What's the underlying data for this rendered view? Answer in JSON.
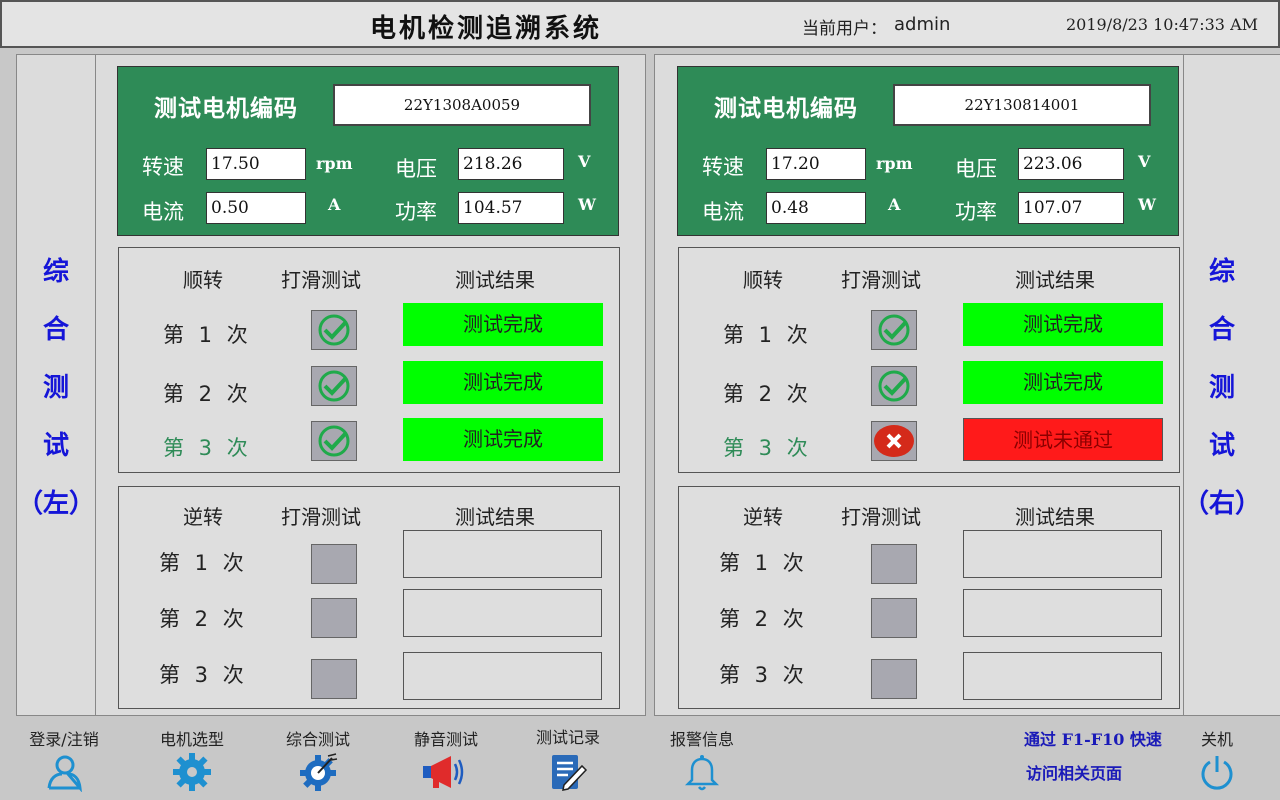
{
  "header": {
    "title": "电机检测追溯系统",
    "user_label": "当前用户：",
    "user_name": "admin",
    "datetime": "2019/8/23 10:47:33 AM"
  },
  "left": {
    "side_label": [
      "综",
      "合",
      "测",
      "试",
      "（左）"
    ],
    "motor_code_label": "测试电机编码",
    "motor_code": "22Y1308A0059",
    "speed_label": "转速",
    "speed": "17.50",
    "speed_unit": "rpm",
    "voltage_label": "电压",
    "voltage": "218.26",
    "voltage_unit": "V",
    "current_label": "电流",
    "current": "0.50",
    "current_unit": "A",
    "power_label": "功率",
    "power": "104.57",
    "power_unit": "W",
    "forward": {
      "head": "顺转",
      "slip_head": "打滑测试",
      "result_head": "测试结果",
      "rows": [
        {
          "label": "第 1 次",
          "state": "pass",
          "result": "测试完成"
        },
        {
          "label": "第 2 次",
          "state": "pass",
          "result": "测试完成"
        },
        {
          "label": "第 3 次",
          "state": "pass",
          "result": "测试完成"
        }
      ]
    },
    "reverse": {
      "head": "逆转",
      "slip_head": "打滑测试",
      "result_head": "测试结果",
      "rows": [
        {
          "label": "第 1 次",
          "state": "empty",
          "result": ""
        },
        {
          "label": "第 2 次",
          "state": "empty",
          "result": ""
        },
        {
          "label": "第 3 次",
          "state": "empty",
          "result": ""
        }
      ]
    }
  },
  "right": {
    "side_label": [
      "综",
      "合",
      "测",
      "试",
      "（右）"
    ],
    "motor_code_label": "测试电机编码",
    "motor_code": "22Y130814001",
    "speed_label": "转速",
    "speed": "17.20",
    "speed_unit": "rpm",
    "voltage_label": "电压",
    "voltage": "223.06",
    "voltage_unit": "V",
    "current_label": "电流",
    "current": "0.48",
    "current_unit": "A",
    "power_label": "功率",
    "power": "107.07",
    "power_unit": "W",
    "forward": {
      "head": "顺转",
      "slip_head": "打滑测试",
      "result_head": "测试结果",
      "rows": [
        {
          "label": "第 1 次",
          "state": "pass",
          "result": "测试完成"
        },
        {
          "label": "第 2 次",
          "state": "pass",
          "result": "测试完成"
        },
        {
          "label": "第 3 次",
          "state": "fail",
          "result": "测试未通过"
        }
      ]
    },
    "reverse": {
      "head": "逆转",
      "slip_head": "打滑测试",
      "result_head": "测试结果",
      "rows": [
        {
          "label": "第 1 次",
          "state": "empty",
          "result": ""
        },
        {
          "label": "第 2 次",
          "state": "empty",
          "result": ""
        },
        {
          "label": "第 3 次",
          "state": "empty",
          "result": ""
        }
      ]
    }
  },
  "nav": [
    {
      "label": "登录/注销",
      "icon": "user-icon"
    },
    {
      "label": "电机选型",
      "icon": "gear-icon"
    },
    {
      "label": "综合测试",
      "icon": "gear-gauge-icon"
    },
    {
      "label": "静音测试",
      "icon": "megaphone-icon"
    },
    {
      "label": "测试记录",
      "icon": "notebook-icon"
    },
    {
      "label": "报警信息",
      "icon": "bell-icon"
    }
  ],
  "hint_line1": "通过 F1-F10 快速",
  "hint_line2": "访问相关页面",
  "power_label": "关机",
  "colors": {
    "panel_green": "#2e8b57",
    "pass": "#00ff00",
    "fail": "#ff1a1a",
    "label_blue": "#1515d8",
    "icon_blue": "#1e90d0"
  }
}
